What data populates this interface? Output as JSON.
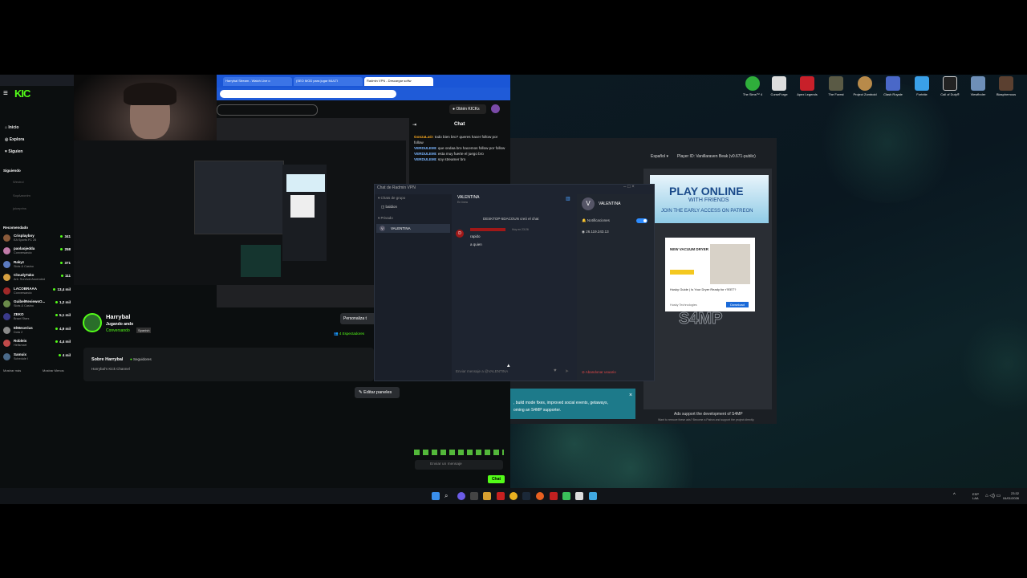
{
  "kick": {
    "nav": {
      "inicio": "Inicio",
      "explora": "Explora",
      "siguiendo": "Siguien"
    },
    "siguiendo_header": "Siguiendo",
    "following": [
      "Westrol",
      "SoyAaronlm",
      "juiceprins"
    ],
    "recomendado_header": "Recomendado",
    "recommended": [
      {
        "name": "Crisplayboy",
        "game": "EA Sports FC 26",
        "viewers": "341"
      },
      {
        "name": "paolaojedda",
        "game": "Conversando",
        "viewers": "258"
      },
      {
        "name": "Rakyz",
        "game": "Slots & Casino",
        "viewers": "371"
      },
      {
        "name": "CloudyTako",
        "game": "Ark: Survival Ascended",
        "viewers": "111"
      },
      {
        "name": "LACOBRAAA",
        "game": "Conversando",
        "viewers": "13,4 mil"
      },
      {
        "name": "GuibelReviewsO...",
        "game": "Slots & Casino",
        "viewers": "1,2 mil"
      },
      {
        "name": "ZEKO",
        "game": "Brawl Stars",
        "viewers": "5,1 mil"
      },
      {
        "name": "ElMecerius",
        "game": "Dota 2",
        "viewers": "4,9 mil"
      },
      {
        "name": "Robleis",
        "game": "Hellsmart",
        "viewers": "4,4 mil"
      },
      {
        "name": "Samuix",
        "game": "Schedule I",
        "viewers": "4 mil"
      }
    ],
    "show_more": "Mostrar más",
    "show_less": "Mostrar Menos",
    "channel": {
      "name": "Harrybal",
      "status": "Jugando ando",
      "category": "Conversando",
      "lang": "Spanish",
      "viewers": "4 Espectadores",
      "customize": "Personaliza t"
    },
    "about": {
      "title": "Sobre Harrybal",
      "followers": "Seguidores",
      "desc": "Harrybal's Kick Channel"
    },
    "edit_panels": "Editar paneles",
    "chat_placeholder": "Enviar un mensaje",
    "chat_button": "Chat",
    "logo": "KIC"
  },
  "chrome": {
    "tabs": [
      "Harrybal Stream - Watch Live o",
      "(SEO MOD para jugar MULTI",
      "Radmin VPN - Descargar softw"
    ],
    "get_kicks": "Obtén KICKs",
    "chat_title": "Chat",
    "messages": [
      {
        "user": "GonzaLaO:",
        "text": "todo bien bro? queres hacer follow por follow"
      },
      {
        "user": "VERDULEMI:",
        "text": "que ondaa bro hacemos follow por follow"
      },
      {
        "user": "VERDULEMI:",
        "text": "esta muy fuerte el juego bro"
      },
      {
        "user": "VERDULEMI:",
        "text": "soy streamer bro"
      }
    ]
  },
  "radmin": {
    "title": "Chat de Radmin VPN",
    "group_header": "Chats de grupo",
    "group_item": "baldion",
    "private_header": "Privado",
    "private_item": "VALENTINA",
    "contact_name": "VALENTINA",
    "contact_status": "En línea",
    "system_msg": "DESKTOP-5DACOUN creó el chat",
    "msg_time": "Hoy en 23:26",
    "msg_lines": [
      "rapido",
      "a quien"
    ],
    "input_placeholder": "Enviar mensaje a @VALENTINA",
    "panel_name": "VALENTINA",
    "notifications": "Notificaciones",
    "ip": "26.119.243.13",
    "leave": "Abandonar usuario",
    "avatar_letter": "V",
    "msg_avatar_letter": "D"
  },
  "s4mp": {
    "lang": "Español",
    "player_id": "Player ID: Vanillaraven Beak (v0.671-public)",
    "banner_title": "PLAY ONLINE",
    "banner_sub": "WITH FRIENDS",
    "banner_cta": "JOIN THE EARLY ACCESS ON PATREON",
    "ad_title": "NEW VACUUM DRYER",
    "ad_text": "Husky Guide | Is Your Dryer Ready for r?EET?",
    "ad_brand": "Husky Technologies",
    "ad_button": "Download",
    "logo": "S4MP",
    "footer": "Ads support the development of S4MP",
    "footer_small": "Want to remove these ads? Become a Patron and support the project directly."
  },
  "notif": {
    "lines": [
      ", build mode fixes, improved social events, getaways,",
      "oming an S4MP supporter."
    ]
  },
  "desktop_icons": [
    "The Sims™ 4",
    "CurseForge",
    "Apex Legends",
    "The Forest",
    "Project Zomboid",
    "Clash Royale",
    "Fortnite",
    "Call of Duty®",
    "Viewfinder",
    "Blasphemous"
  ],
  "clock": {
    "time": "23:32",
    "date": "04/01/2026",
    "lang": "ESP\nLAA"
  }
}
